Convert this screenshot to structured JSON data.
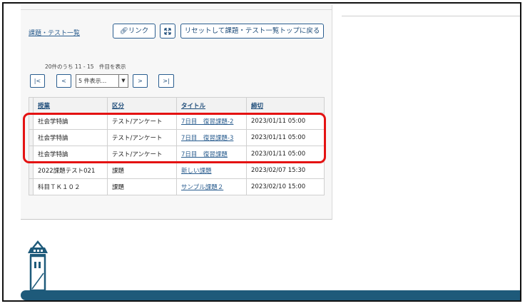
{
  "header": {
    "list_link": "課題・テスト一覧",
    "link_button": "リンク",
    "reset_button": "リセットして課題・テスト一覧トップに戻る"
  },
  "pager": {
    "summary": "20件のうち 11 - 15　件目を表示",
    "first": "|<",
    "prev": "<",
    "page_size": "5 件表示...",
    "next": ">",
    "last": ">|"
  },
  "table": {
    "headers": {
      "class": "授業",
      "kind": "区分",
      "title": "タイトル",
      "deadline": "締切"
    },
    "rows": [
      {
        "class": "社会学特論",
        "kind": "テスト/アンケート",
        "title": "7日目　復習課題-2",
        "deadline": "2023/01/11 05:00"
      },
      {
        "class": "社会学特論",
        "kind": "テスト/アンケート",
        "title": "7日目　復習課題-3",
        "deadline": "2023/01/11 05:00"
      },
      {
        "class": "社会学特論",
        "kind": "テスト/アンケート",
        "title": "7日目　復習課題",
        "deadline": "2023/01/11 05:00"
      },
      {
        "class": "2022課題テスト021",
        "kind": "課題",
        "title": "新しい課題",
        "deadline": "2023/02/07 15:30"
      },
      {
        "class": "科目ＴＫ１０２",
        "kind": "課題",
        "title": "サンプル課題２",
        "deadline": "2023/02/10 15:00"
      }
    ]
  },
  "colors": {
    "accent": "#2a5d8f",
    "highlight": "#e41212",
    "footer": "#1e5a7a"
  },
  "icons": {
    "link": "link-icon",
    "expand": "expand-icon",
    "dropdown": "chevron-down-icon",
    "logo": "building-logo"
  }
}
